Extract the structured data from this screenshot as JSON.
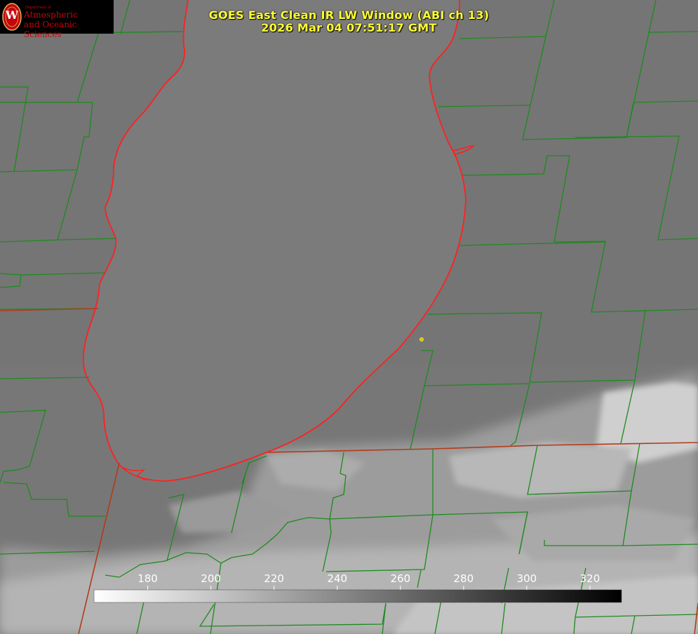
{
  "title_line1": "GOES East Clean IR LW Window (ABI ch 13)",
  "title_line2": "2026 Mar 04 07:51:17 GMT",
  "logo": {
    "dept": "Department of",
    "line1": "Atmospheric",
    "line2": "and Oceanic Sciences",
    "seal_letter": "W"
  },
  "colorbar": {
    "min": 163,
    "max": 330,
    "ticks": [
      "180",
      "200",
      "220",
      "240",
      "260",
      "280",
      "300",
      "320"
    ],
    "gradient": "white-to-black"
  },
  "colors": {
    "title": "#ffff33",
    "lake_outline": "#ff2020",
    "county_lines": "#1e8a1e",
    "state_lines": "#b33a1a",
    "marker": "#d7c72a"
  }
}
